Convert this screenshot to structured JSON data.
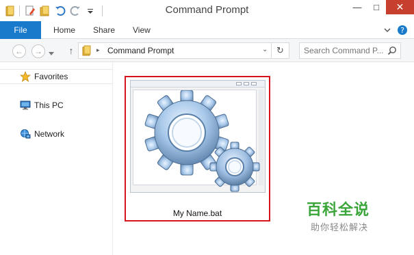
{
  "window": {
    "title": "Command Prompt",
    "minimize_glyph": "—",
    "maximize_glyph": "□",
    "close_glyph": "✕"
  },
  "ribbon": {
    "tabs": [
      {
        "label": "File"
      },
      {
        "label": "Home"
      },
      {
        "label": "Share"
      },
      {
        "label": "View"
      }
    ],
    "help_glyph": "?",
    "expand_glyph": "⌵"
  },
  "address_bar": {
    "back_glyph": "←",
    "forward_glyph": "→",
    "up_glyph": "↑",
    "separator_glyph": "▸",
    "path": "Command Prompt",
    "dropdown_glyph": "⌄",
    "refresh_glyph": "↻"
  },
  "search": {
    "placeholder": "Search Command P..."
  },
  "nav_pane": {
    "items": [
      {
        "label": "Favorites",
        "icon": "star-icon"
      },
      {
        "label": "This PC",
        "icon": "computer-icon"
      },
      {
        "label": "Network",
        "icon": "network-icon"
      }
    ]
  },
  "content": {
    "files": [
      {
        "name": "My Name.bat",
        "icon": "gears-icon",
        "selected": true
      }
    ]
  },
  "watermark": {
    "main": "百科全说",
    "sub": "助你轻松解决"
  },
  "colors": {
    "file_tab": "#1979ca",
    "close_button": "#c7402d",
    "selection_border": "#d6131a",
    "watermark": "#3aa63a"
  }
}
